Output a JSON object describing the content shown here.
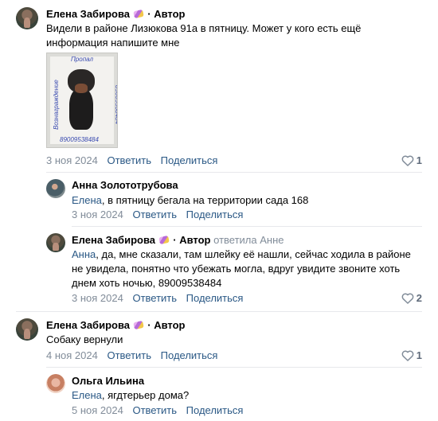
{
  "comments": [
    {
      "author": "Елена Забирова",
      "role": "· Автор",
      "text_lines": [
        "Видели в районе Лизюкова 91а в пятницу. Может у кого есть ещё",
        "информация напишите мне"
      ],
      "photo": {
        "caption_top": "Пропал",
        "caption_left": "Вознаграждение",
        "caption_right": "89009538484",
        "caption_bottom": "89009538484"
      },
      "date": "3 ноя 2024",
      "reply_label": "Ответить",
      "share_label": "Поделиться",
      "likes": "1"
    },
    {
      "author": "Анна Золототрубова",
      "mention": "Елена",
      "text": ", в пятницу бегала на территории сада 168",
      "date": "3 ноя 2024",
      "reply_label": "Ответить",
      "share_label": "Поделиться"
    },
    {
      "author": "Елена Забирова",
      "role": "· Автор",
      "reply_to": "ответила Анне",
      "mention": "Анна",
      "text_first": ", да, мне сказали, там шлейку её нашли, сейчас ходила в районе",
      "text_lines": [
        "не увидела, понятно что убежать могла, вдруг увидите звоните хоть",
        "днем хоть ночью, 89009538484"
      ],
      "date": "3 ноя 2024",
      "reply_label": "Ответить",
      "share_label": "Поделиться",
      "likes": "2"
    },
    {
      "author": "Елена Забирова",
      "role": "· Автор",
      "text": "Собаку вернули",
      "date": "4 ноя 2024",
      "reply_label": "Ответить",
      "share_label": "Поделиться",
      "likes": "1"
    },
    {
      "author": "Ольга Ильина",
      "mention": "Елена",
      "text": ", ягдтерьер дома?",
      "date": "5 ноя 2024",
      "reply_label": "Ответить",
      "share_label": "Поделиться"
    }
  ],
  "colors": {
    "link": "#2a5885",
    "muted": "#818c99",
    "divider": "#e7e8ec"
  },
  "icons": {
    "like": "heart-outline-icon"
  }
}
